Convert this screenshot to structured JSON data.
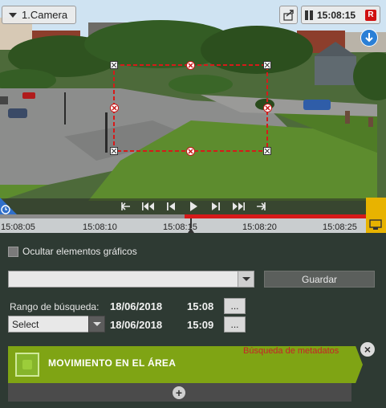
{
  "camera": {
    "label": "1.Camera"
  },
  "clock": {
    "time": "15:08:15",
    "rec_badge": "R"
  },
  "timeline": {
    "ticks": [
      "15:08:05",
      "15:08:10",
      "15:08:15",
      "15:08:20",
      "15:08:25"
    ]
  },
  "controls": {
    "hide_graphics_label": "Ocultar elementos gráficos",
    "hide_graphics_checked": false,
    "preset_value": "",
    "save_label": "Guardar",
    "range_label": "Rango de búsqueda:",
    "from_date": "18/06/2018",
    "from_time": "15:08",
    "to_date": "18/06/2018",
    "to_time": "15:09",
    "more_label": "...",
    "select_value": "Select"
  },
  "metadata": {
    "title": "MOVIMIENTO EN EL ÁREA",
    "tag": "Búsqueda de metadatos",
    "close_label": "×",
    "add_label": "+"
  },
  "icons": {
    "camera_menu": "dropdown-triangle-icon",
    "export": "export-icon",
    "pause": "pause-icon",
    "download": "download-arrow-icon",
    "clock": "clock-icon",
    "windows": "window-icon"
  },
  "colors": {
    "accent_green": "#7fa414",
    "timeline_red": "#d61a1a",
    "rec_red": "#d01010",
    "zone_red": "#d61a1a",
    "corner_yellow": "#e8b300"
  }
}
